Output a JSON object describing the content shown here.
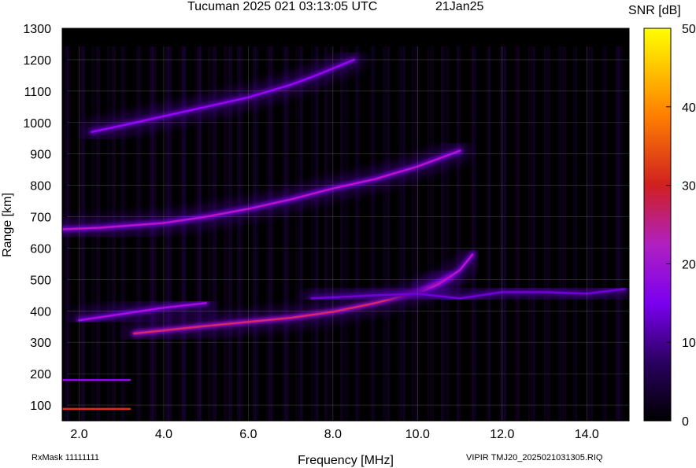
{
  "header": {
    "title": "Tucuman 2025 021 03:13:05 UTC",
    "date": "21Jan25",
    "colorbar_label": "SNR [dB]"
  },
  "footer": {
    "left": "RxMask 11111111",
    "right": "VIPIR  TMJ20_2025021031305.RIQ"
  },
  "chart_data": {
    "type": "heatmap",
    "title": "Tucuman 2025 021 03:13:05 UTC",
    "xlabel": "Frequency [MHz]",
    "ylabel": "Range [km]",
    "xlim": [
      1.6,
      15.0
    ],
    "ylim": [
      50,
      1300
    ],
    "x_ticks": [
      "2.0",
      "4.0",
      "6.0",
      "8.0",
      "10.0",
      "12.0",
      "14.0"
    ],
    "x_tick_values": [
      2,
      4,
      6,
      8,
      10,
      12,
      14
    ],
    "y_ticks": [
      "100",
      "200",
      "300",
      "400",
      "500",
      "600",
      "700",
      "800",
      "900",
      "1000",
      "1100",
      "1200",
      "1300"
    ],
    "y_tick_values": [
      100,
      200,
      300,
      400,
      500,
      600,
      700,
      800,
      900,
      1000,
      1100,
      1200,
      1300
    ],
    "colorbar": {
      "label": "SNR [dB]",
      "range": [
        0,
        50
      ],
      "ticks": [
        "0",
        "10",
        "20",
        "30",
        "40",
        "50"
      ],
      "tick_values": [
        0,
        10,
        20,
        30,
        40,
        50
      ],
      "colors": [
        "#000000",
        "#3a0080",
        "#8a00ff",
        "#d020a0",
        "#e03000",
        "#ff9000",
        "#ffff00"
      ]
    },
    "grid": true,
    "traces": [
      {
        "name": "",
        "x": [
          1.6,
          2.0,
          2.5,
          3.0,
          3.2
        ],
        "y": [
          88,
          88,
          88,
          88,
          88
        ],
        "snr": 32
      },
      {
        "name": "",
        "x": [
          1.6,
          2.5,
          3.2
        ],
        "y": [
          180,
          180,
          180
        ],
        "snr": 18
      },
      {
        "name": "",
        "x": [
          3.3,
          4.0,
          5.0,
          6.0,
          7.0,
          8.0,
          9.0,
          10.0,
          10.8
        ],
        "y": [
          328,
          338,
          352,
          365,
          378,
          397,
          425,
          460,
          510
        ],
        "snr": 28
      },
      {
        "name": "",
        "x": [
          10.0,
          10.5,
          11.0,
          11.3
        ],
        "y": [
          455,
          485,
          530,
          580
        ],
        "snr": 22
      },
      {
        "name": "",
        "x": [
          2.0,
          3.0,
          4.0,
          5.0
        ],
        "y": [
          370,
          390,
          410,
          425
        ],
        "snr": 20
      },
      {
        "name": "",
        "x": [
          1.6,
          2.5,
          3.0,
          4.0,
          5.0,
          6.0,
          7.0,
          8.0,
          9.0,
          10.0,
          11.0
        ],
        "y": [
          660,
          665,
          670,
          680,
          700,
          725,
          755,
          790,
          820,
          860,
          910
        ],
        "snr": 22
      },
      {
        "name": "",
        "x": [
          2.3,
          3.0,
          4.0,
          5.0,
          6.0,
          7.0,
          7.6,
          8.5
        ],
        "y": [
          970,
          990,
          1020,
          1050,
          1080,
          1120,
          1150,
          1200
        ],
        "snr": 18
      },
      {
        "name": "",
        "x": [
          7.5,
          9.0,
          10.0,
          11.0,
          12.0,
          13.0,
          14.0,
          14.9
        ],
        "y": [
          440,
          450,
          455,
          440,
          460,
          460,
          455,
          470
        ],
        "snr": 14
      }
    ]
  }
}
